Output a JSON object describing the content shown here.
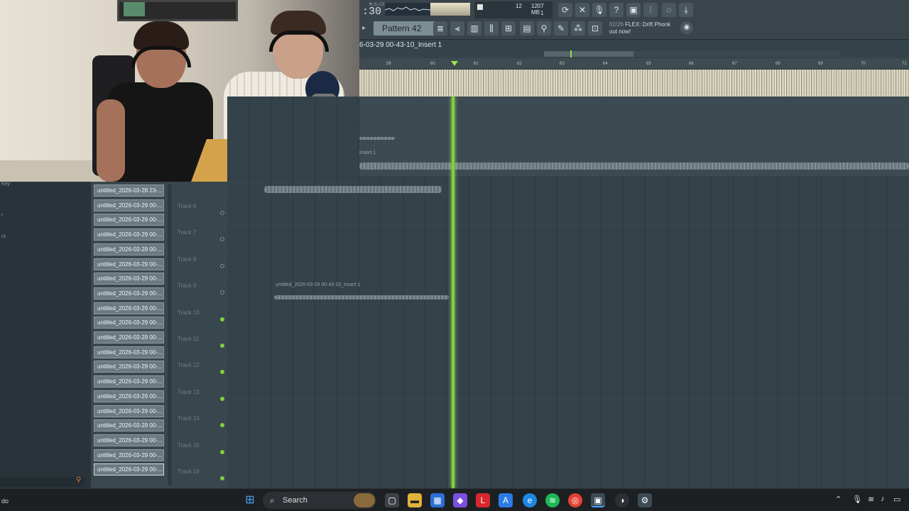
{
  "toolbar": {
    "time": ":30",
    "time_label": "M:S:CS",
    "cpu_num": "12",
    "memory": "1207 MB",
    "voices": "1",
    "pattern": "Pattern 42",
    "hint_count": "02/26",
    "hint_text": "FLEX: Drift Phonk",
    "hint_text2": "out now!",
    "icons": [
      "loop-icon",
      "metronome-icon",
      "microphone-icon",
      "help-icon",
      "save-icon",
      "mixer-icon",
      "chat-icon",
      "download-icon"
    ]
  },
  "playlist": {
    "clip_title": "6-03-29 00-43-10_Insert 1",
    "ruler_ticks": [
      "58",
      "60",
      "61",
      "62",
      "63",
      "64",
      "65",
      "66",
      "67",
      "68",
      "69",
      "70",
      "71"
    ],
    "clip_label_small": "Insert 1",
    "clip_label_mid": "untitled_2026-03-29 00-43-10_Insert 1"
  },
  "left_panel": {
    "items": [
      "Key",
      "r",
      "rs"
    ]
  },
  "browser": {
    "files": [
      "untitled_2026-03-28 23-...",
      "untitled_2026-03-29 00-...",
      "untitled_2026-03-29 00-...",
      "untitled_2026-03-29 00-...",
      "untitled_2026-03-29 00-...",
      "untitled_2026-03-29 00-...",
      "untitled_2026-03-29 00-...",
      "untitled_2026-03-29 00-...",
      "untitled_2026-03-29 00-...",
      "untitled_2026-03-29 00-...",
      "untitled_2026-03-29 00-...",
      "untitled_2026-03-29 00-...",
      "untitled_2026-03-29 00-...",
      "untitled_2026-03-29 00-...",
      "untitled_2026-03-29 00-...",
      "untitled_2026-03-29 00-...",
      "untitled_2026-03-29 00-...",
      "untitled_2026-03-29 00-...",
      "untitled_2026-03-29 00-...",
      "untitled_2026-03-29 00-..."
    ]
  },
  "tracks": [
    "Track 6",
    "Track 7",
    "Track 8",
    "Track 9",
    "Track 10",
    "Track 11",
    "Track 12",
    "Track 13",
    "Track 14",
    "Track 15",
    "Track 16"
  ],
  "taskbar": {
    "left_text": "do",
    "search": "Search"
  }
}
